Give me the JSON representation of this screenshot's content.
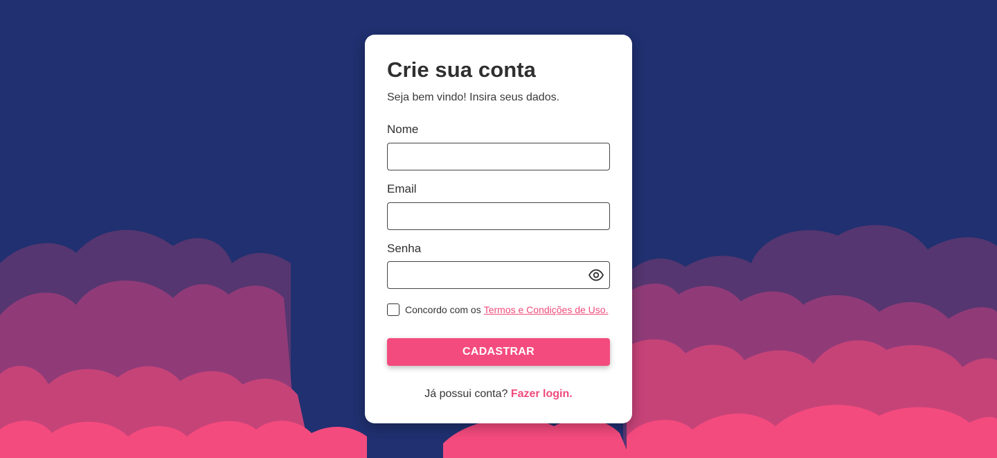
{
  "theme": {
    "background": "#203070",
    "accent": "#f44b7e",
    "wave_colors": [
      "#553670",
      "#903b78",
      "#c64378",
      "#f44b7e"
    ]
  },
  "form": {
    "title": "Crie sua conta",
    "subtitle": "Seja bem vindo! Insira seus dados.",
    "name_label": "Nome",
    "name_value": "",
    "email_label": "Email",
    "email_value": "",
    "password_label": "Senha",
    "password_value": "",
    "password_toggle_icon": "eye-icon",
    "terms_checked": false,
    "terms_prefix": "Concordo com os",
    "terms_link": "Termos e Condições de Uso.",
    "submit_label": "CADASTRAR",
    "login_prompt": "Já possui conta?",
    "login_link": "Fazer login."
  }
}
